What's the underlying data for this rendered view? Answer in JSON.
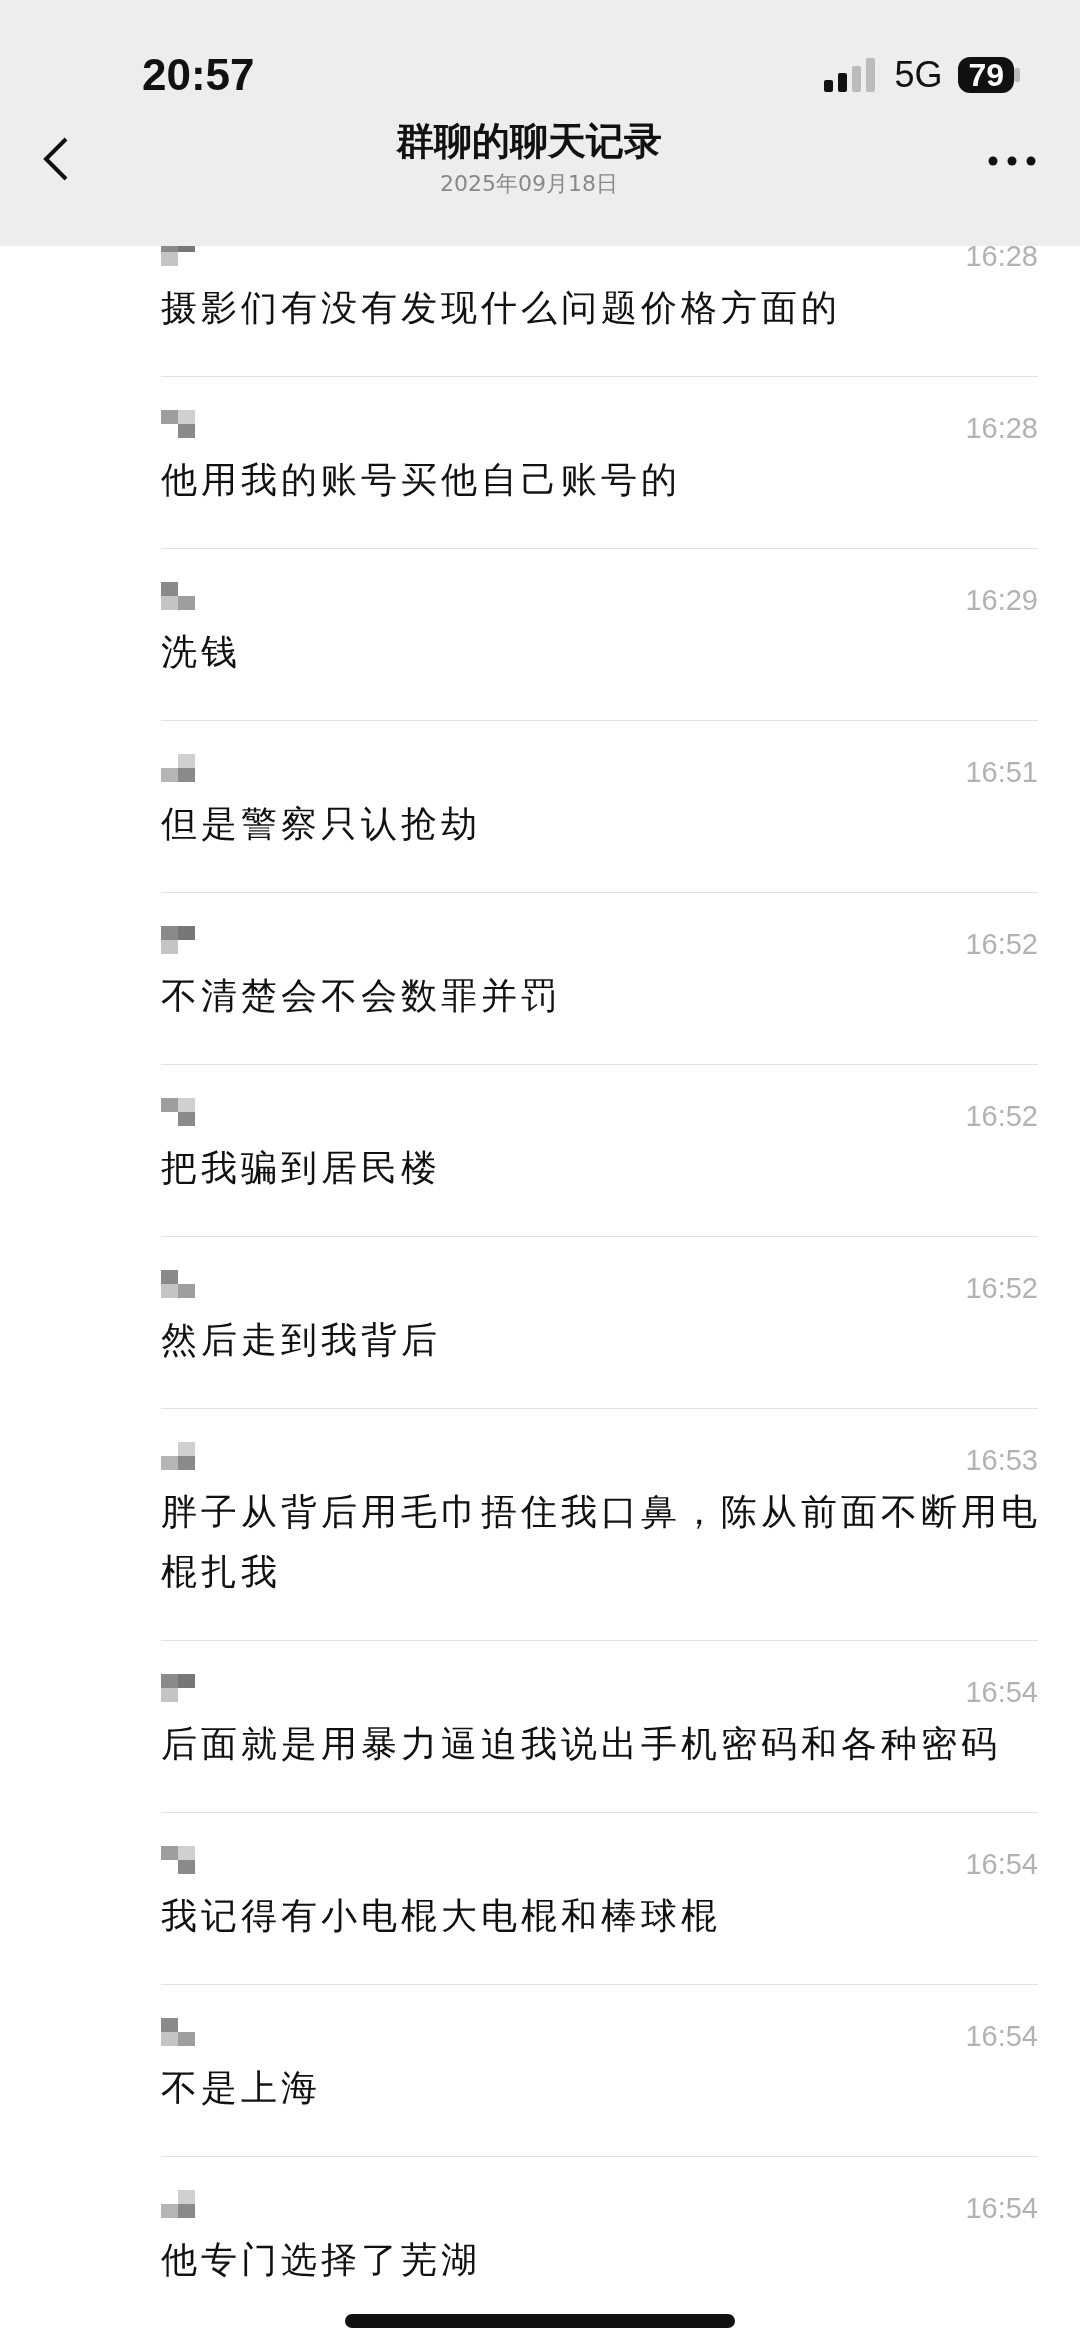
{
  "status_bar": {
    "time": "20:57",
    "network": "5G",
    "battery": "79"
  },
  "header": {
    "title": "群聊的聊天记录",
    "date": "2025年09月18日"
  },
  "messages": [
    {
      "time": "16:28",
      "text": "摄影们有没有发现什么问题价格方面的"
    },
    {
      "time": "16:28",
      "text": "他用我的账号买他自己账号的"
    },
    {
      "time": "16:29",
      "text": "洗钱"
    },
    {
      "time": "16:51",
      "text": "但是警察只认抢劫"
    },
    {
      "time": "16:52",
      "text": "不清楚会不会数罪并罚"
    },
    {
      "time": "16:52",
      "text": "把我骗到居民楼"
    },
    {
      "time": "16:52",
      "text": "然后走到我背后"
    },
    {
      "time": "16:53",
      "text": "胖子从背后用毛巾捂住我口鼻，陈从前面不断用电棍扎我"
    },
    {
      "time": "16:54",
      "text": "后面就是用暴力逼迫我说出手机密码和各种密码"
    },
    {
      "time": "16:54",
      "text": "我记得有小电棍大电棍和棒球棍"
    },
    {
      "time": "16:54",
      "text": "不是上海"
    },
    {
      "time": "16:54",
      "text": "他专门选择了芜湖"
    }
  ]
}
